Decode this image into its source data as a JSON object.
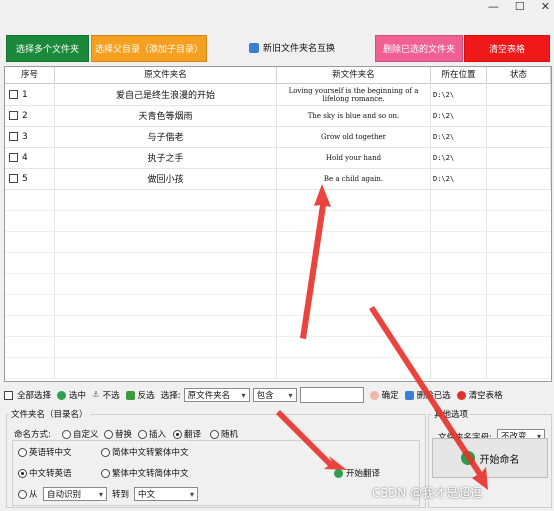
{
  "window": {
    "minimize": "—",
    "maximize": "☐",
    "close": "✕"
  },
  "top_buttons": {
    "add_multiple": "选择多个文件夹",
    "select_parent": "选择父目录（添加子目录）",
    "swap_names": "新旧文件夹名互换",
    "delete_selected": "删除已选的文件夹",
    "clear_table": "清空表格"
  },
  "table": {
    "headers": [
      "序号",
      "原文件夹名",
      "新文件夹名",
      "所在位置",
      "状态"
    ],
    "rows": [
      {
        "index": "1",
        "old": "爱自己是终生浪漫的开始",
        "new": "Loving yourself is the beginning of a lifelong romance.",
        "location": "D:\\2\\",
        "status": ""
      },
      {
        "index": "2",
        "old": "天青色等烟雨",
        "new": "The sky is blue and so on.",
        "location": "D:\\2\\",
        "status": ""
      },
      {
        "index": "3",
        "old": "与子偕老",
        "new": "Grow old together",
        "location": "D:\\2\\",
        "status": ""
      },
      {
        "index": "4",
        "old": "执子之手",
        "new": "Hold your hand",
        "location": "D:\\2\\",
        "status": ""
      },
      {
        "index": "5",
        "old": "做回小孩",
        "new": "Be a child again.",
        "location": "D:\\2\\",
        "status": ""
      }
    ]
  },
  "toolbar": {
    "select_all": "全部选择",
    "select_checked": "选中",
    "uncheck": "不选",
    "invert": "反选",
    "select_label": "选择:",
    "field_value": "原文件夹名",
    "match_value": "包含",
    "input_value": "",
    "confirm": "确定",
    "delete_selected": "删除已选",
    "clear_table": "清空表格"
  },
  "naming": {
    "group_title": "文件夹名（目录名）",
    "method_label": "命名方式:",
    "methods": [
      "自定义",
      "替换",
      "插入",
      "翻译",
      "随机"
    ],
    "selected_method": "翻译",
    "translate_options": [
      "英语转中文",
      "简体中文转繁体中文",
      "中文转英语",
      "繁体中文转简体中文"
    ],
    "selected_translate": "中文转英语",
    "from_label": "从",
    "from_value": "自动识别",
    "to_label": "转到",
    "to_value": "中文",
    "start_translate": "开始翻译"
  },
  "other": {
    "group_title": "其他选项",
    "case_label": "文件夹名字母:",
    "case_value": "不改变",
    "start_button": "开始命名"
  },
  "watermark": "CSDN @我才是超逗"
}
